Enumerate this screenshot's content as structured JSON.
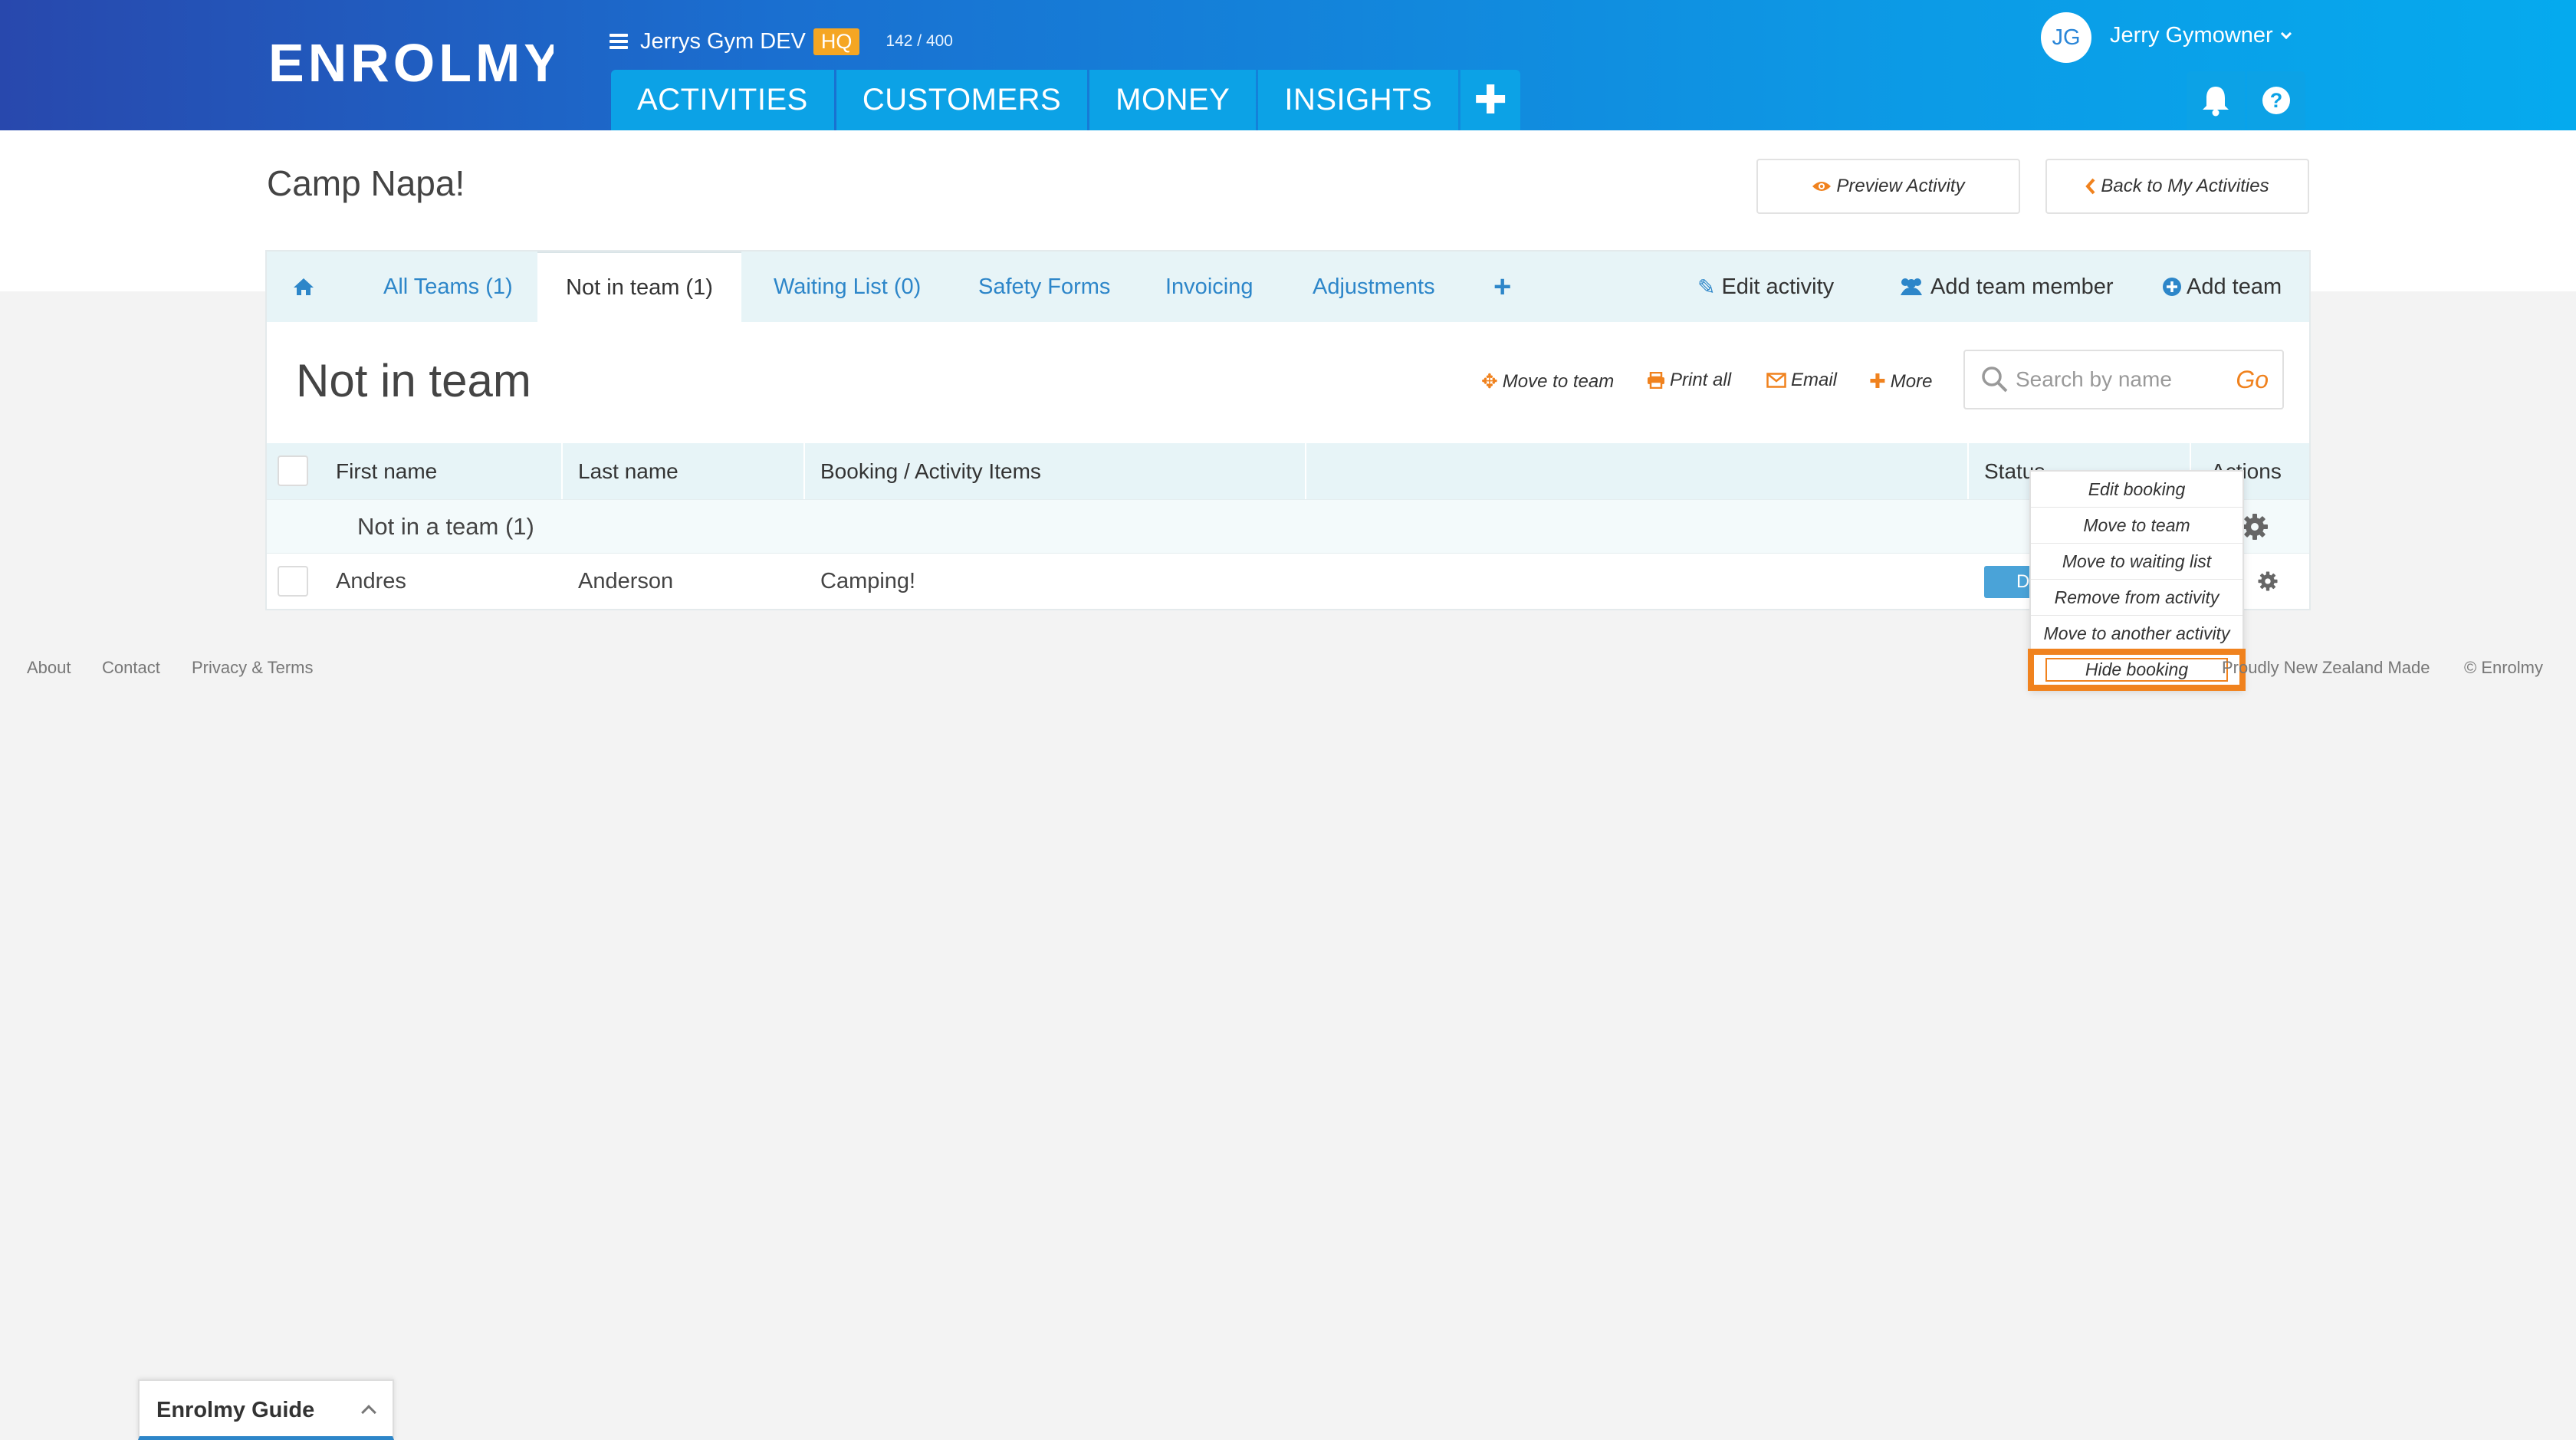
{
  "header": {
    "logo": "ENROLMY",
    "org_name": "Jerrys Gym DEV",
    "org_badge": "HQ",
    "count": "142 / 400",
    "nav": [
      "ACTIVITIES",
      "CUSTOMERS",
      "MONEY",
      "INSIGHTS"
    ],
    "add_label": "✚",
    "avatar_initials": "JG",
    "user_name": "Jerry Gymowner",
    "help": "?"
  },
  "page": {
    "title": "Camp Napa!",
    "preview_label": "Preview Activity",
    "back_label": "Back to My Activities"
  },
  "tabs": {
    "items": [
      "All Teams (1)",
      "Not in team (1)",
      "Waiting List (0)",
      "Safety Forms",
      "Invoicing",
      "Adjustments"
    ],
    "add": "+",
    "edit_activity": "Edit activity",
    "add_team_member": "Add team member",
    "add_team": "Add team"
  },
  "section": {
    "title": "Not in team",
    "move_to_team": "Move to team",
    "print_all": "Print all",
    "email": "Email",
    "more": "More",
    "search_placeholder": "Search by name",
    "go": "Go"
  },
  "table": {
    "headers": [
      "First name",
      "Last name",
      "Booking / Activity Items",
      "Status",
      "Actions"
    ],
    "group_label": "Not in a team  (1)",
    "rows": [
      {
        "first": "Andres",
        "last": "Anderson",
        "items": "Camping!",
        "status": "D"
      }
    ]
  },
  "dropdown": {
    "items": [
      "Edit booking",
      "Move to team",
      "Move to waiting list",
      "Remove from activity",
      "Move to another activity",
      "Hide booking"
    ],
    "highlighted": "Hide booking"
  },
  "footer": {
    "links": [
      "About",
      "Contact",
      "Privacy & Terms"
    ],
    "made": "Proudly New Zealand Made",
    "copyright": "© Enrolmy"
  },
  "guide": {
    "label": "Enrolmy Guide"
  },
  "colors": {
    "accent_orange": "#f0821e",
    "link_blue": "#2d86c9",
    "header_start": "#2848ad",
    "header_end": "#05aaee"
  }
}
